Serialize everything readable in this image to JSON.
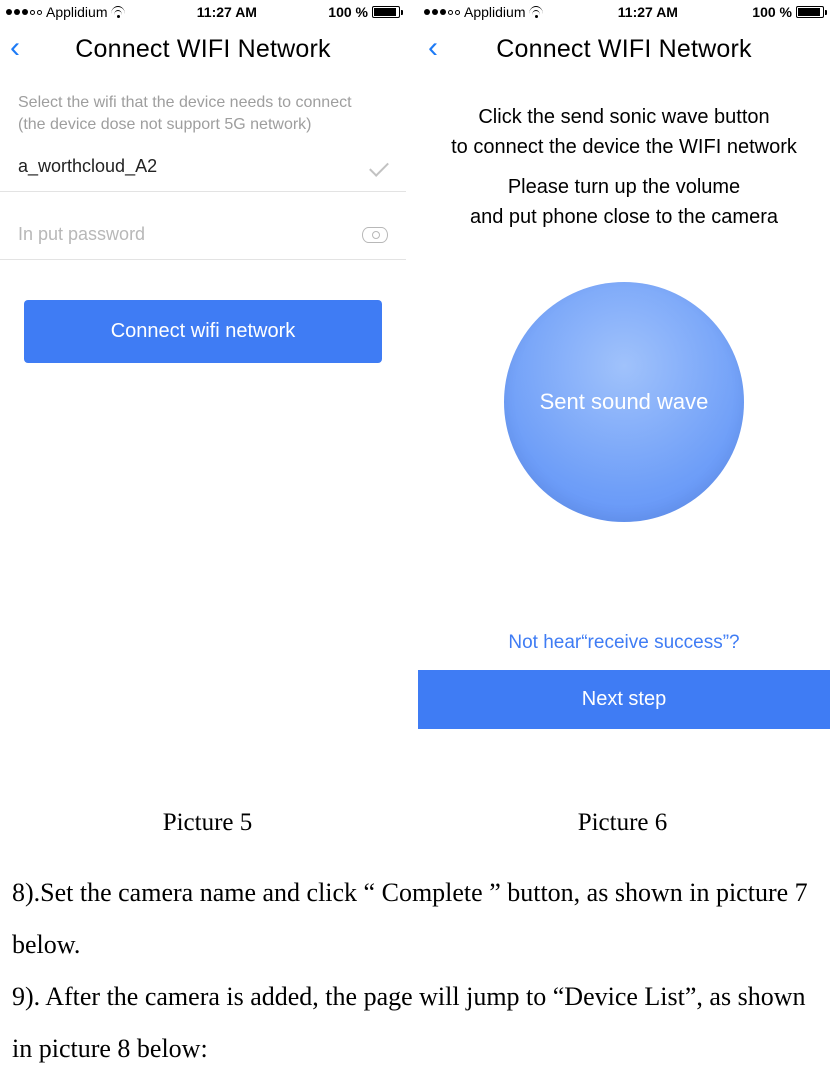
{
  "statusbar": {
    "carrier": "Applidium",
    "time": "11:27 AM",
    "battery": "100 %"
  },
  "screen1": {
    "title": "Connect WIFI Network",
    "hint_line1": "Select the wifi that the device needs to connect",
    "hint_line2": "(the device dose not support 5G network)",
    "wifi_name": "a_worthcloud_A2",
    "password_placeholder": "In put password",
    "connect_btn": "Connect wifi network"
  },
  "screen2": {
    "title": "Connect WIFI Network",
    "instruct_line1": "Click the send sonic wave button",
    "instruct_line2": "to connect the device the WIFI network",
    "instruct_line3": "Please turn up the volume",
    "instruct_line4": "and put phone close to the camera",
    "sound_btn": "Sent sound wave",
    "not_hear": "Not hear“receive success”?",
    "next_btn": "Next step"
  },
  "captions": {
    "left": "Picture 5",
    "right": "Picture 6"
  },
  "doc": {
    "p1": "8).Set the camera name and click “ Complete ” button, as shown in picture 7 below.",
    "p2": "9). After the camera is added, the page will jump to “Device List”, as shown in picture 8 below:"
  }
}
